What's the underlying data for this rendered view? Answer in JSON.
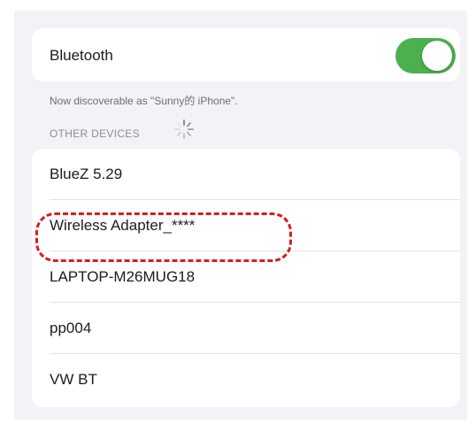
{
  "bluetooth": {
    "label": "Bluetooth",
    "enabled": true,
    "toggle_color": "#4caf50",
    "discoverable_text": "Now discoverable as \"Sunny的 iPhone\"."
  },
  "other_devices": {
    "header": "OTHER DEVICES",
    "loading_icon": "spinner-icon",
    "items": [
      {
        "name": "BlueZ 5.29"
      },
      {
        "name": "Wireless Adapter_****",
        "highlighted": true
      },
      {
        "name": "LAPTOP-M26MUG18"
      },
      {
        "name": "pp004"
      },
      {
        "name": "VW BT"
      }
    ]
  },
  "highlight": {
    "color": "#d32020",
    "style": "dashed"
  }
}
